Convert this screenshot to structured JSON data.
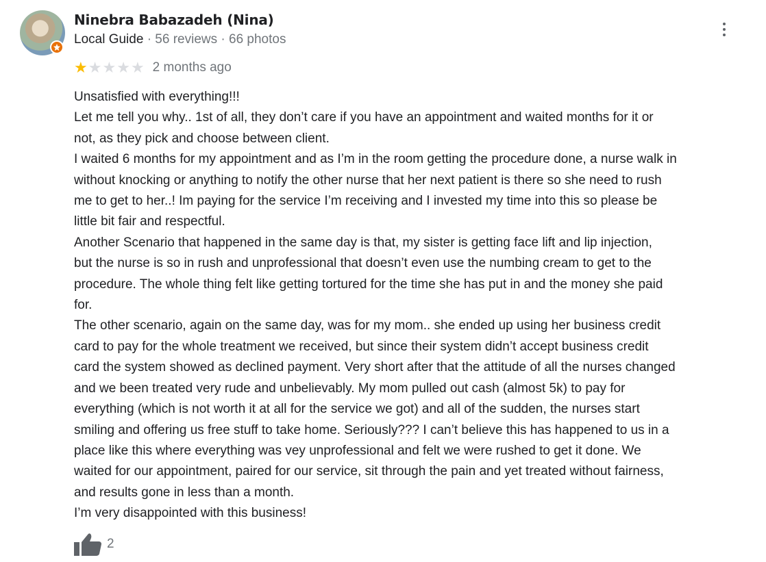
{
  "review": {
    "author": "Ninebra Babazadeh (Nina)",
    "badge": "Local Guide",
    "separator": "·",
    "reviews_count": "56 reviews",
    "photos_count": "66 photos",
    "rating": 1,
    "rating_max": 5,
    "date": "2 months ago",
    "lines": [
      "Unsatisfied  with everything!!!",
      "Let me tell you why.. 1st of all, they don’t care if you have an appointment and waited months for it or",
      "not, as they pick and choose between client.",
      "I waited 6 months for my appointment and as I’m in the room getting the procedure done, a nurse walk in",
      "without knocking or anything to notify the other nurse that her next patient is there so she need to rush",
      "me to get to her..! Im paying for the service I’m receiving and I invested my time into this so please be",
      "little bit fair and respectful.",
      "Another Scenario  that happened in the same day is that, my sister is getting face lift and lip injection,",
      "but the nurse is so in rush and unprofessional that doesn’t even use the numbing cream to get to the",
      "procedure. The whole thing felt like getting tortured for the time she has put in and the money she paid",
      "for.",
      "The other scenario, again on the same day, was for my mom.. she ended up using her business credit",
      "card to pay for the whole treatment we received, but since their system didn’t accept business credit",
      "card the system showed as declined payment. Very short after that the attitude of all the nurses changed",
      "and we been treated very rude and unbelievably. My mom pulled out cash (almost 5k) to pay for",
      "everything (which is not worth it at all for the service we got) and all of the sudden, the nurses start",
      "smiling and offering us free stuff to take home. Seriously??? I can’t believe this has happened to us in a",
      "place like this where everything was vey unprofessional and felt we were rushed to get it done. We",
      "waited for our appointment, paired for our service, sit through the pain and yet treated without fairness,",
      "and results gone in less than a month.",
      "I’m very disappointed with this business!"
    ],
    "likes": "2"
  },
  "icons": {
    "avatar": "profile-photo",
    "badge": "local-guide-star-icon",
    "more": "more-vert-icon",
    "star": "star-icon",
    "like": "thumbs-up-icon"
  },
  "colors": {
    "star_filled": "#fbbc04",
    "star_empty": "#dadce0",
    "badge": "#e8710a",
    "secondary_text": "#70757a",
    "primary_text": "#202124"
  }
}
